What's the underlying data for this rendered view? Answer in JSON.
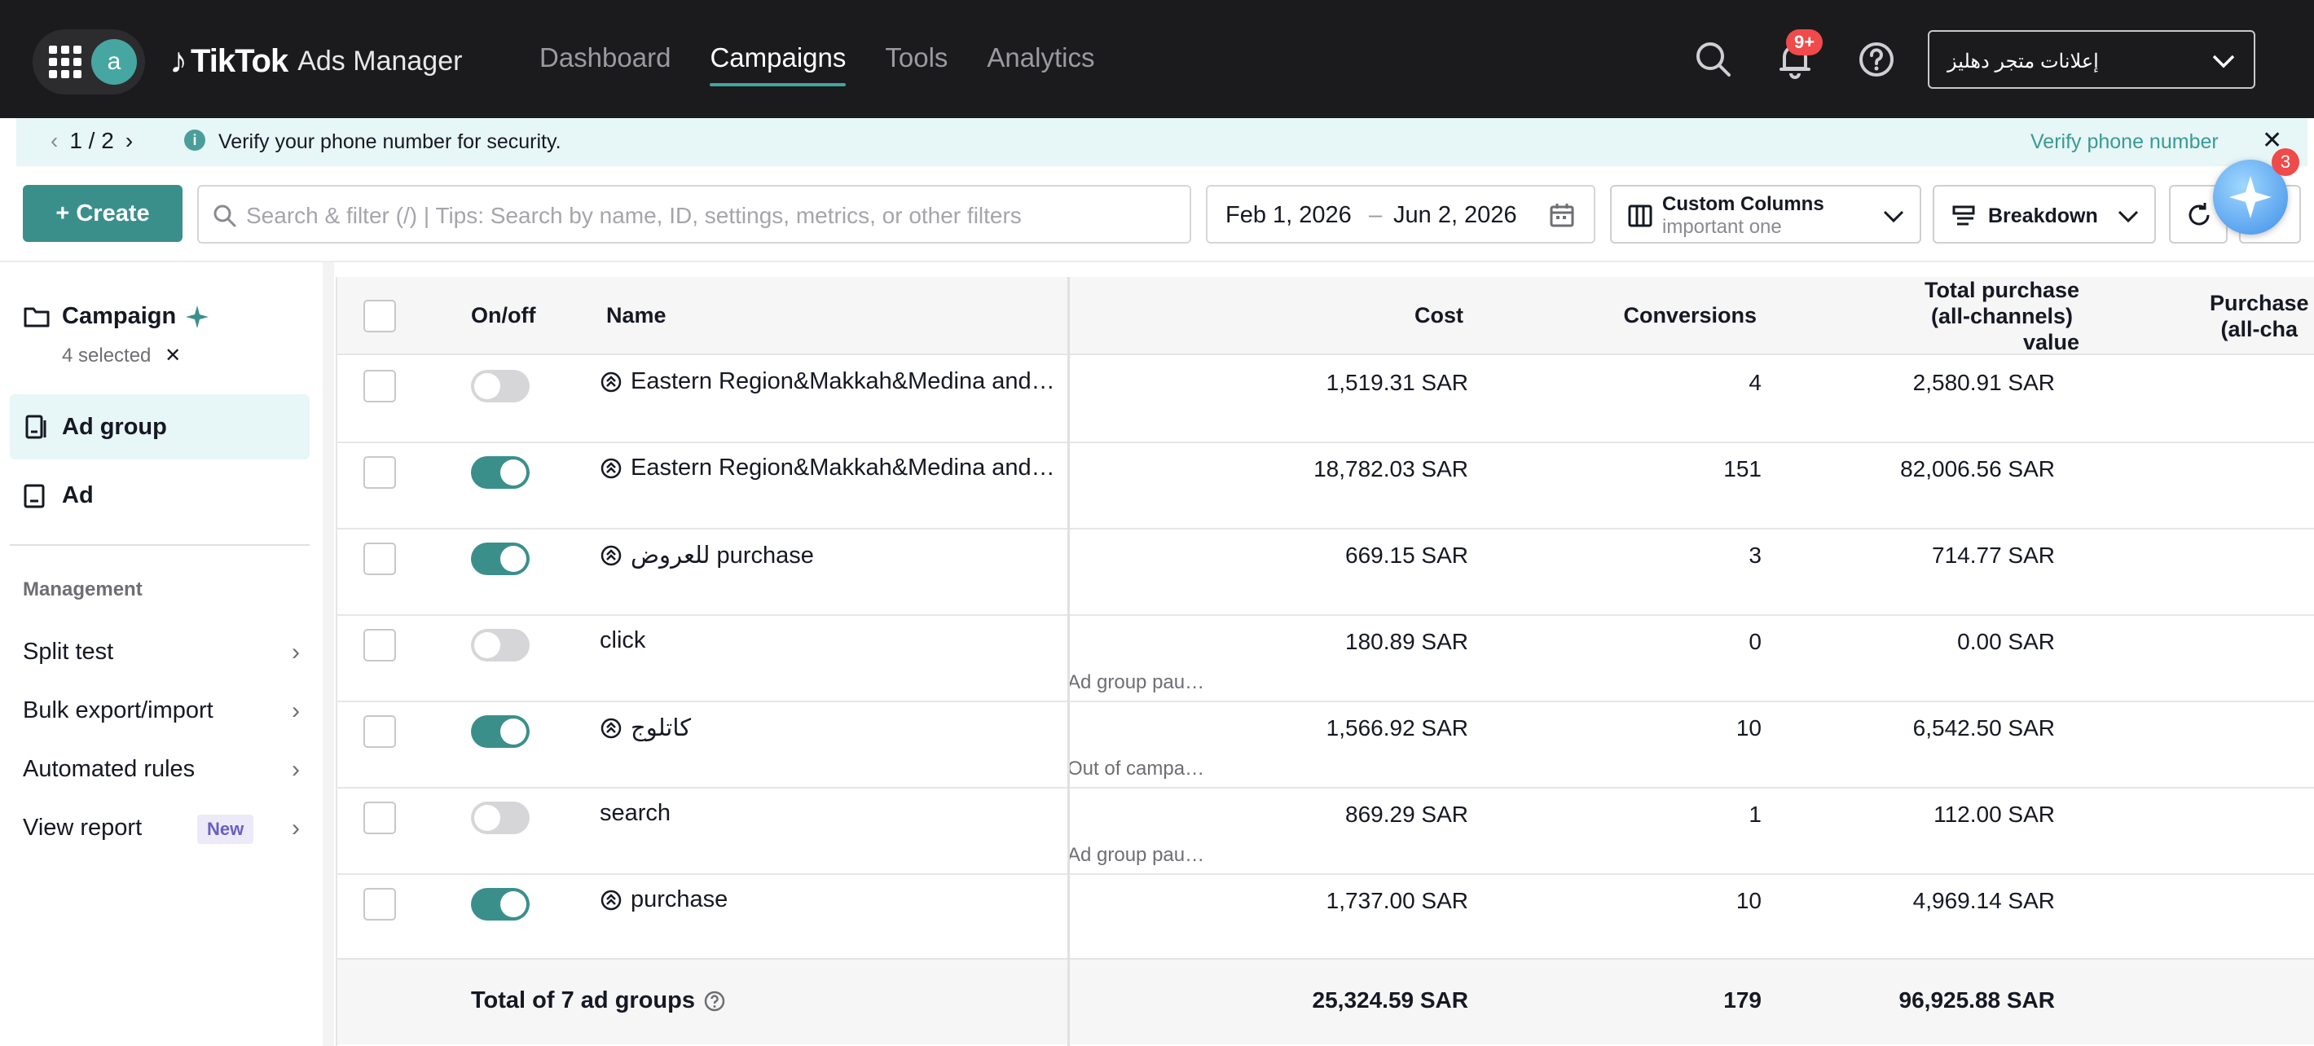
{
  "header": {
    "avatar_letter": "a",
    "logo_brand": "TikTok",
    "logo_sub": "Ads Manager",
    "nav": [
      {
        "label": "Dashboard",
        "active": false
      },
      {
        "label": "Campaigns",
        "active": true
      },
      {
        "label": "Tools",
        "active": false
      },
      {
        "label": "Analytics",
        "active": false
      }
    ],
    "notifications_badge": "9+",
    "account_name": "إعلانات متجر دهليز"
  },
  "notice": {
    "pager": "1 / 2",
    "message": "Verify your phone number for security.",
    "action": "Verify phone number"
  },
  "toolbar": {
    "create_label": "+ Create",
    "search_placeholder": "Search & filter (/) | Tips: Search by name, ID, settings, metrics, or other filters",
    "date_start": "Feb 1, 2026",
    "date_sep": "–",
    "date_end": "Jun 2, 2026",
    "columns_title": "Custom Columns",
    "columns_value": "important one",
    "breakdown_label": "Breakdown",
    "assistant_badge": "3"
  },
  "sidebar": {
    "campaign_label": "Campaign",
    "selected_text": "4 selected",
    "adgroup_label": "Ad group",
    "ad_label": "Ad",
    "management_label": "Management",
    "menu": [
      {
        "label": "Split test"
      },
      {
        "label": "Bulk export/import"
      },
      {
        "label": "Automated rules"
      },
      {
        "label": "View report",
        "badge": "New"
      }
    ]
  },
  "table": {
    "headers": {
      "onoff": "On/off",
      "name": "Name",
      "cost": "Cost",
      "conversions": "Conversions",
      "total_purchase_1": "Total purchase",
      "total_purchase_2": "(all-channels)",
      "total_purchase_3": "value",
      "purchase_1": "Purchase",
      "purchase_2": "(all-cha"
    },
    "rows": [
      {
        "on": false,
        "name": "Eastern Region&Makkah&Medina and…",
        "status": "",
        "cost": "1,519.31 SAR",
        "conversions": "4",
        "value": "2,580.91 SAR"
      },
      {
        "on": true,
        "name": "Eastern Region&Makkah&Medina and…",
        "status": "",
        "cost": "18,782.03 SAR",
        "conversions": "151",
        "value": "82,006.56 SAR"
      },
      {
        "on": true,
        "name": "للعروض purchase",
        "status": "",
        "cost": "669.15 SAR",
        "conversions": "3",
        "value": "714.77 SAR"
      },
      {
        "on": false,
        "name": "click",
        "status": "Ad group pau…",
        "cost": "180.89 SAR",
        "conversions": "0",
        "value": "0.00 SAR"
      },
      {
        "on": true,
        "name": "كاتلوج",
        "status": "Out of campa…",
        "cost": "1,566.92 SAR",
        "conversions": "10",
        "value": "6,542.50 SAR"
      },
      {
        "on": false,
        "name": "search",
        "status": "Ad group pau…",
        "cost": "869.29 SAR",
        "conversions": "1",
        "value": "112.00 SAR"
      },
      {
        "on": true,
        "name": "purchase",
        "status": "",
        "cost": "1,737.00 SAR",
        "conversions": "10",
        "value": "4,969.14 SAR"
      }
    ],
    "total": {
      "label": "Total of 7 ad groups",
      "cost": "25,324.59 SAR",
      "conversions": "179",
      "value": "96,925.88 SAR"
    }
  },
  "colors": {
    "accent": "#3b8f8b",
    "topbar": "#1b1b1d",
    "notice_bg": "#e7f6f6",
    "badge": "#f04a4a"
  }
}
